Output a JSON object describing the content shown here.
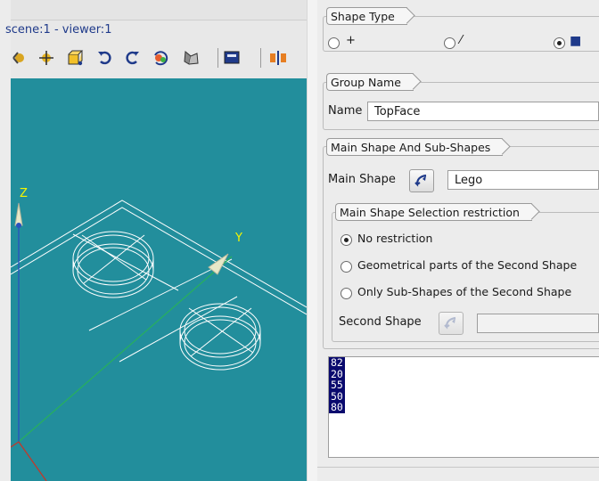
{
  "viewer": {
    "title": "scene:1 - viewer:1",
    "toolbar": [
      {
        "icon": "rotate-icon"
      },
      {
        "icon": "pan-icon"
      },
      {
        "icon": "view-box-icon"
      },
      {
        "icon": "undo-icon"
      },
      {
        "icon": "redo-icon"
      },
      {
        "icon": "reset-view-icon"
      },
      {
        "icon": "light-icon"
      },
      {
        "icon": "screen-icon"
      },
      {
        "icon": "clipping-icon"
      }
    ],
    "axes": {
      "y_label": "Y",
      "z_label": "Z"
    },
    "colors": {
      "background": "#228e9c",
      "wire": "#ffffff",
      "x_axis": "#c0392b",
      "y_axis": "#27ae60",
      "z_axis": "#2a52be"
    }
  },
  "panel": {
    "shape_type": {
      "title": "Shape Type",
      "options": [
        {
          "glyph": "+",
          "selected": false
        },
        {
          "glyph": "⁄",
          "selected": false
        },
        {
          "glyph": "■",
          "selected": true
        }
      ]
    },
    "group_name": {
      "title": "Group Name",
      "name_label": "Name",
      "name_value": "TopFace"
    },
    "main_shape": {
      "title": "Main Shape And Sub-Shapes",
      "main_shape_label": "Main Shape",
      "main_shape_value": "Lego",
      "restriction": {
        "title": "Main Shape Selection restriction",
        "options": [
          {
            "label": "No restriction",
            "selected": true
          },
          {
            "label": "Geometrical parts of the Second Shape",
            "selected": false
          },
          {
            "label": "Only Sub-Shapes of the Second Shape",
            "selected": false
          }
        ],
        "second_shape_label": "Second Shape",
        "second_shape_value": ""
      }
    },
    "ids": [
      "82",
      "20",
      "55",
      "50",
      "80"
    ],
    "colors": {
      "selection": "#0a0a6e",
      "accent_blue": "#1f3a8a"
    }
  }
}
